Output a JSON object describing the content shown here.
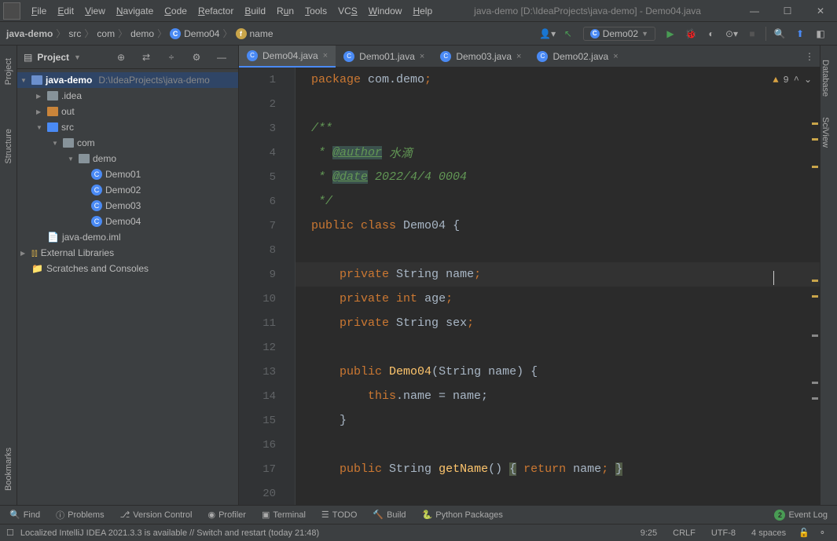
{
  "title": "java-demo [D:\\IdeaProjects\\java-demo] - Demo04.java",
  "menus": [
    "File",
    "Edit",
    "View",
    "Navigate",
    "Code",
    "Refactor",
    "Build",
    "Run",
    "Tools",
    "VCS",
    "Window",
    "Help"
  ],
  "breadcrumb": {
    "project": "java-demo",
    "src": "src",
    "com": "com",
    "demo": "demo",
    "class": "Demo04",
    "field": "name"
  },
  "runconfig": "Demo02",
  "project_header": "Project",
  "tree": {
    "root": "java-demo",
    "root_path": "D:\\IdeaProjects\\java-demo",
    "idea": ".idea",
    "out": "out",
    "src": "src",
    "com": "com",
    "demo": "demo",
    "files": [
      "Demo01",
      "Demo02",
      "Demo03",
      "Demo04"
    ],
    "iml": "java-demo.iml",
    "ext": "External Libraries",
    "scratch": "Scratches and Consoles"
  },
  "tabs": [
    {
      "label": "Demo04.java",
      "active": true
    },
    {
      "label": "Demo01.java",
      "active": false
    },
    {
      "label": "Demo03.java",
      "active": false
    },
    {
      "label": "Demo02.java",
      "active": false
    }
  ],
  "lines": [
    "1",
    "2",
    "3",
    "4",
    "5",
    "6",
    "7",
    "8",
    "9",
    "10",
    "11",
    "12",
    "13",
    "14",
    "15",
    "16",
    "17",
    "20"
  ],
  "code": {
    "l1_pkg": "package",
    "l1_val": "com.demo",
    "l3": "/**",
    "l4_tag": "@author",
    "l4_rest": " 水滴",
    "l5_tag": "@date",
    "l5_rest": " 2022/4/4 0004",
    "l6": " */",
    "l7_pub": "public class",
    "l7_cls": "Demo04",
    "l7_brace": " {",
    "l9_mod": "private",
    "l9_type": "String",
    "l9_name": "name",
    "l10_mod": "private int",
    "l10_name": "age",
    "l11_mod": "private",
    "l11_type": "String",
    "l11_name": "sex",
    "l13_mod": "public",
    "l13_cls": "Demo04",
    "l13_args": "(String name) {",
    "l14_this": "this",
    "l14_rest": ".name = name;",
    "l15": "}",
    "l17_mod": "public",
    "l17_type": "String",
    "l17_fn": "getName",
    "l17_mid": "() ",
    "l17_ret": "return",
    "l17_name": "name"
  },
  "warn_count": "9",
  "tools": [
    "Find",
    "Problems",
    "Version Control",
    "Profiler",
    "Terminal",
    "TODO",
    "Build",
    "Python Packages"
  ],
  "event_log": "Event Log",
  "event_count": "2",
  "status_msg": "Localized IntelliJ IDEA 2021.3.3 is available // Switch and restart (today 21:48)",
  "status_right": {
    "pos": "9:25",
    "le": "CRLF",
    "enc": "UTF-8",
    "indent": "4 spaces"
  },
  "right_tabs": [
    "Database",
    "SciView"
  ],
  "left_tabs": [
    "Project",
    "Structure",
    "Bookmarks"
  ]
}
